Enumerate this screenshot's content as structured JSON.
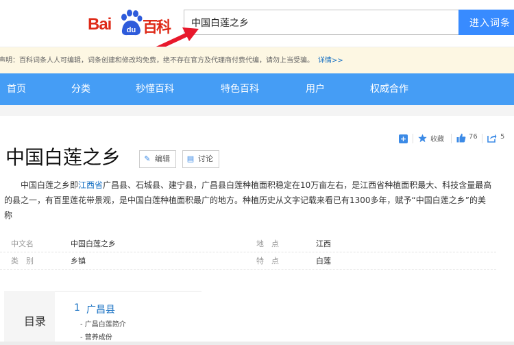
{
  "header": {
    "logo_bai": "Bai",
    "logo_du": "du",
    "logo_baike": "百科",
    "search_value": "中国白莲之乡",
    "search_button": "进入词条"
  },
  "notice": {
    "text": "声明：百科词条人人可编辑，词条创建和修改均免费，绝不存在官方及代理商付费代编，请勿上当受骗。",
    "more": "详情>>"
  },
  "nav": {
    "items": [
      "首页",
      "分类",
      "秒懂百科",
      "特色百科",
      "用户",
      "权威合作"
    ]
  },
  "toolbar": {
    "add_icon": "plus-icon",
    "collect_label": "收藏",
    "like_count": "76",
    "share_count": "5"
  },
  "entry": {
    "title": "中国白莲之乡",
    "edit_label": "编辑",
    "discuss_label": "讨论",
    "summary_pre": "中国白莲之乡即",
    "summary_link": "江西省",
    "summary_post": "广昌县、石城县、建宁县，广昌县白莲种植面积稳定在10万亩左右，是江西省种植面积最大、科技含量最高的县之一，有百里莲花带景观，是中国白莲种植面积最广的地方。种植历史从文字记载来看已有1300多年，赋予“中国白莲之乡”的美称"
  },
  "info": {
    "rows": [
      {
        "l1": "中文名",
        "v1": "中国白莲之乡",
        "l2": "地　点",
        "v2": "江西"
      },
      {
        "l1": "类　别",
        "v1": "乡镇",
        "l2": "特　点",
        "v2": "白莲"
      }
    ]
  },
  "catalog": {
    "title": "目录",
    "item_num": "1",
    "item_label": "广昌县",
    "sub1": "广昌白莲简介",
    "sub2": "营养成份"
  },
  "colors": {
    "brand_red": "#de2a18",
    "brand_blue": "#2e5bdb",
    "nav_blue": "#459df5",
    "button_blue": "#388bff",
    "annotation_red": "#e8192c"
  }
}
